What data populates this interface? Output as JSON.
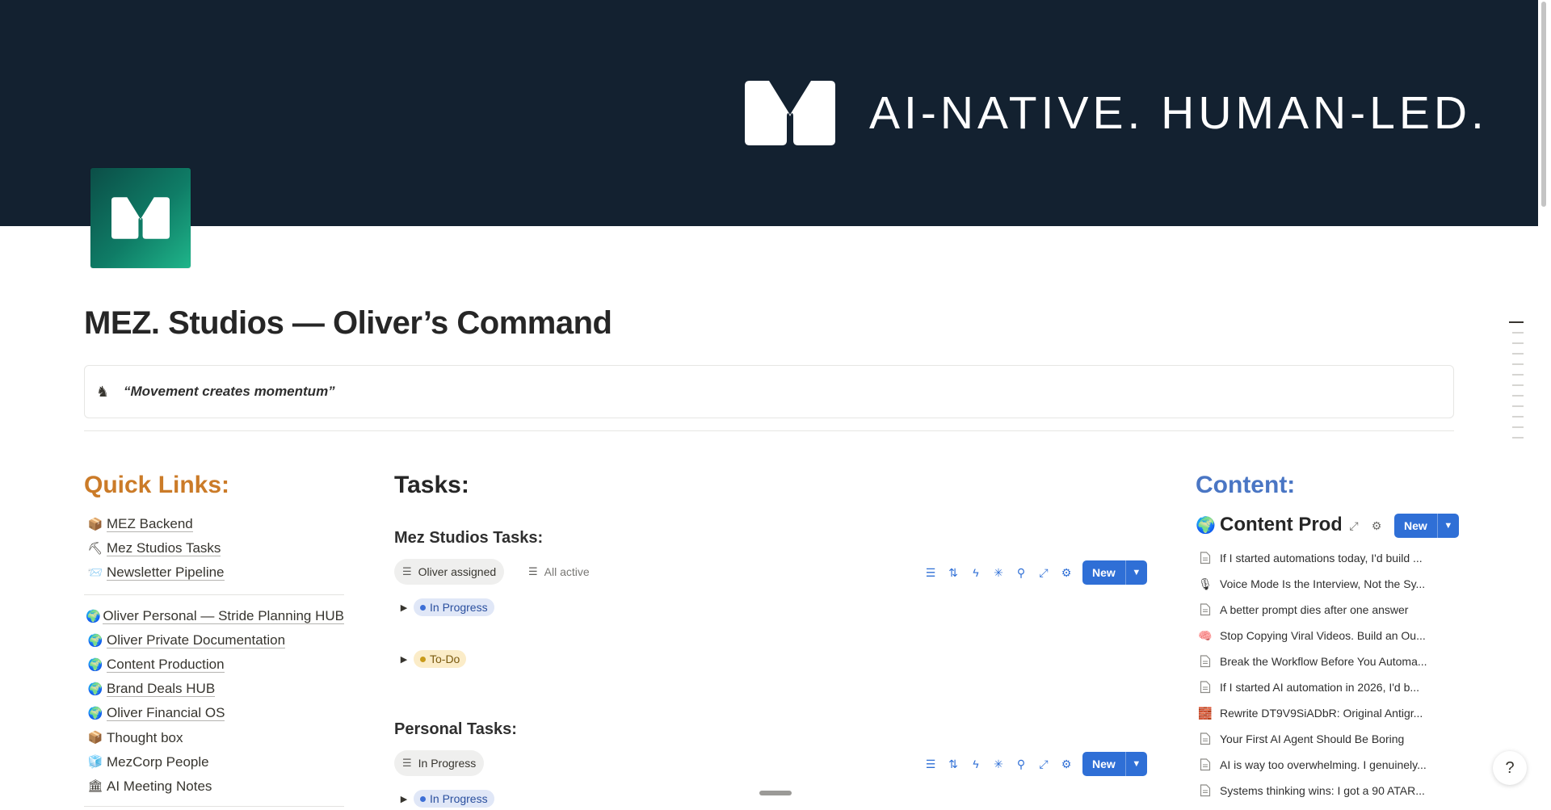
{
  "cover": {
    "tagline": "AI-NATIVE. HUMAN-LED."
  },
  "page": {
    "title": "MEZ. Studios — Oliver’s Command",
    "callout": {
      "icon": "chess-knight-icon",
      "emoji": "♞",
      "text": "“Movement creates momentum”"
    }
  },
  "quick_links": {
    "heading": "Quick Links:",
    "group1": [
      {
        "emoji": "📦",
        "label": "MEZ Backend"
      },
      {
        "emoji": "⛏",
        "label": "Mez Studios Tasks"
      },
      {
        "emoji": "📨",
        "label": "Newsletter Pipeline"
      }
    ],
    "group2": [
      {
        "emoji": "🌍",
        "label": "Oliver Personal — Stride Planning HUB"
      },
      {
        "emoji": "🌍",
        "label": "Oliver Private Documentation"
      },
      {
        "emoji": "🌍",
        "label": "Content Production"
      },
      {
        "emoji": "🌍",
        "label": "Brand Deals HUB"
      },
      {
        "emoji": "🌍",
        "label": "Oliver Financial OS"
      },
      {
        "emoji": "📦",
        "label": "Thought box"
      },
      {
        "emoji": "🧊",
        "label": "MezCorp People"
      },
      {
        "emoji": "🏛",
        "label": "AI Meeting Notes"
      }
    ]
  },
  "tasks": {
    "heading": "Tasks:",
    "mez": {
      "title": "Mez Studios Tasks:",
      "views": [
        "Oliver assigned",
        "All active"
      ],
      "new_label": "New",
      "groups": [
        "In Progress",
        "To-Do"
      ]
    },
    "personal": {
      "title": "Personal Tasks:",
      "views": [
        "In Progress"
      ],
      "new_label": "New",
      "groups": [
        "In Progress"
      ]
    }
  },
  "content": {
    "heading": "Content:",
    "db_title": "Content Production",
    "new_label": "New",
    "items": [
      {
        "icon": "document-icon",
        "title": "If I started automations today, I'd build ..."
      },
      {
        "icon": "microphone-icon",
        "title": "Voice Mode Is the Interview, Not the Sy..."
      },
      {
        "icon": "document-icon",
        "title": "A better prompt dies after one answer"
      },
      {
        "icon": "brain-icon",
        "title": "Stop Copying Viral Videos. Build an Ou..."
      },
      {
        "icon": "document-icon",
        "title": "Break the Workflow Before You Automa..."
      },
      {
        "icon": "document-icon",
        "title": "If I started AI automation in 2026, I'd b..."
      },
      {
        "icon": "brick-icon",
        "title": "Rewrite DT9V9SiADbR: Original Antigr..."
      },
      {
        "icon": "document-icon",
        "title": "Your First AI Agent Should Be Boring"
      },
      {
        "icon": "document-icon",
        "title": "AI is way too overwhelming. I genuinely..."
      },
      {
        "icon": "document-icon",
        "title": "Systems thinking wins: I got a 90 ATAR..."
      }
    ]
  },
  "help": {
    "label": "?"
  },
  "colors": {
    "cover_bg": "#132130",
    "quick_links_heading": "#cb7b28",
    "content_heading": "#4a76c4",
    "accent_blue": "#2f6fd6"
  }
}
